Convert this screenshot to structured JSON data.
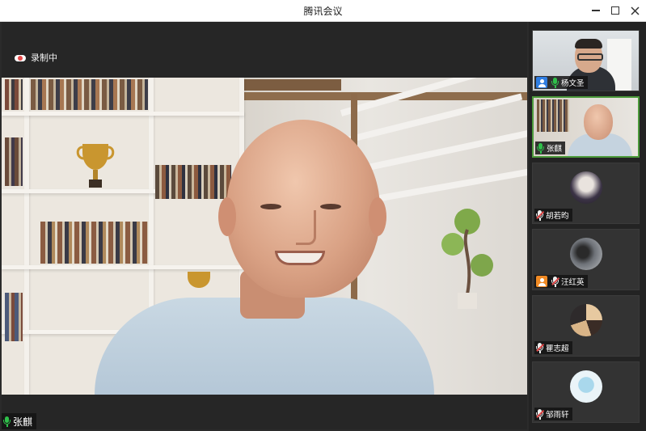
{
  "window": {
    "title": "腾讯会议"
  },
  "main_video": {
    "recording_label": "录制中",
    "speaker_name": "张麒",
    "speaker_mic": "on"
  },
  "colors": {
    "mic_active": "#2fbf4a",
    "mic_muted_slash": "#e04646",
    "active_tile_border": "#4c9a3b",
    "host_badge": "#2f7de1",
    "cohost_badge": "#f08a24"
  },
  "participants": [
    {
      "name": "杨文圣",
      "mic": "on",
      "badge": "host-icon",
      "video": "camera"
    },
    {
      "name": "张麒",
      "mic": "on",
      "badge": "",
      "video": "camera",
      "active": true
    },
    {
      "name": "胡若昀",
      "mic": "muted",
      "badge": "",
      "video": "avatar"
    },
    {
      "name": "汪红英",
      "mic": "muted",
      "badge": "cohost-icon",
      "video": "avatar"
    },
    {
      "name": "瞿志超",
      "mic": "muted",
      "badge": "",
      "video": "avatar"
    },
    {
      "name": "邹雨轩",
      "mic": "muted",
      "badge": "",
      "video": "avatar"
    }
  ]
}
